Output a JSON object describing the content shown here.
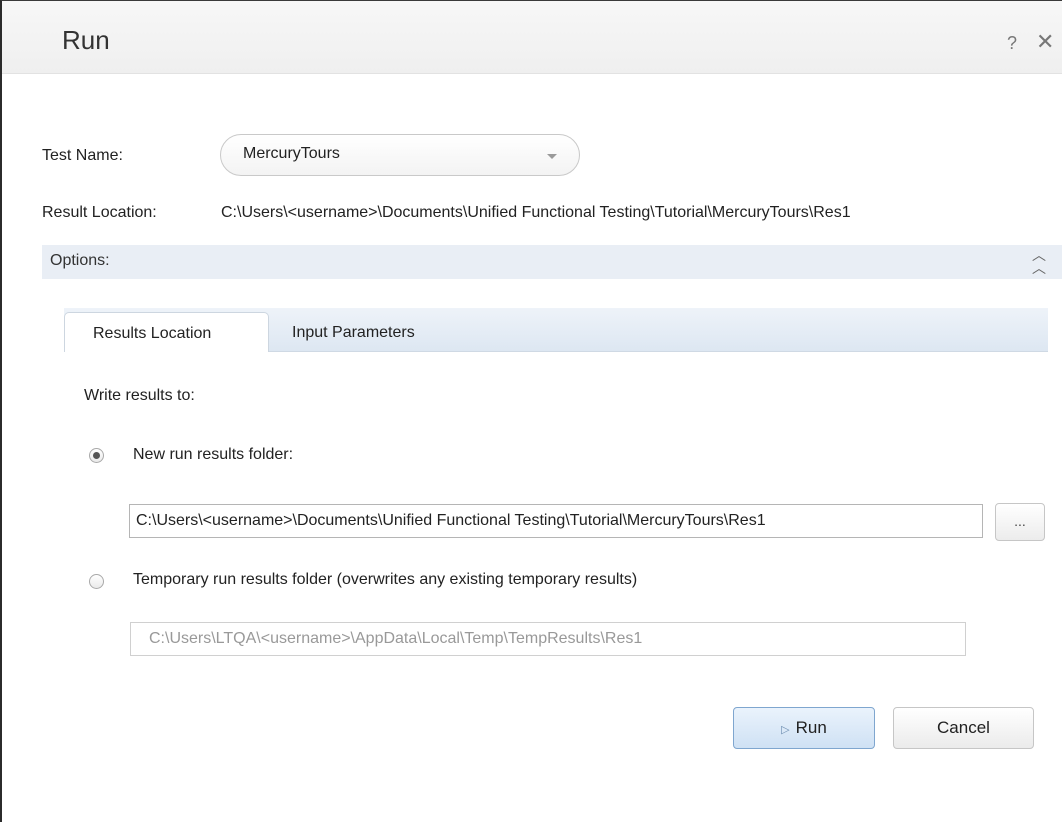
{
  "dialog": {
    "title": "Run",
    "help_label": "?",
    "close_label": "✕"
  },
  "test_name": {
    "label": "Test Name:",
    "value": "MercuryTours"
  },
  "result_location": {
    "label": "Result Location:",
    "value": "C:\\Users\\<username>\\Documents\\Unified Functional Testing\\Tutorial\\MercuryTours\\Res1"
  },
  "options": {
    "label": "Options:",
    "collapse_icon": "double-chevron-up-icon"
  },
  "tabs": [
    {
      "label": "Results Location",
      "active": true
    },
    {
      "label": "Input Parameters",
      "active": false
    }
  ],
  "results_location": {
    "write_label": "Write results to:",
    "new_folder_label": "New run results folder:",
    "new_folder_selected": true,
    "new_folder_path": "C:\\Users\\<username>\\Documents\\Unified Functional Testing\\Tutorial\\MercuryTours\\Res1",
    "browse_label": "...",
    "temp_folder_label": "Temporary run results folder (overwrites any existing temporary results)",
    "temp_folder_selected": false,
    "temp_folder_path": "C:\\Users\\LTQA\\<username>\\AppData\\Local\\Temp\\TempResults\\Res1"
  },
  "buttons": {
    "run_label": "Run",
    "run_icon": "play-icon",
    "cancel_label": "Cancel"
  },
  "colors": {
    "accent": "#cfe1f4",
    "options_bar": "#e9eef5"
  }
}
